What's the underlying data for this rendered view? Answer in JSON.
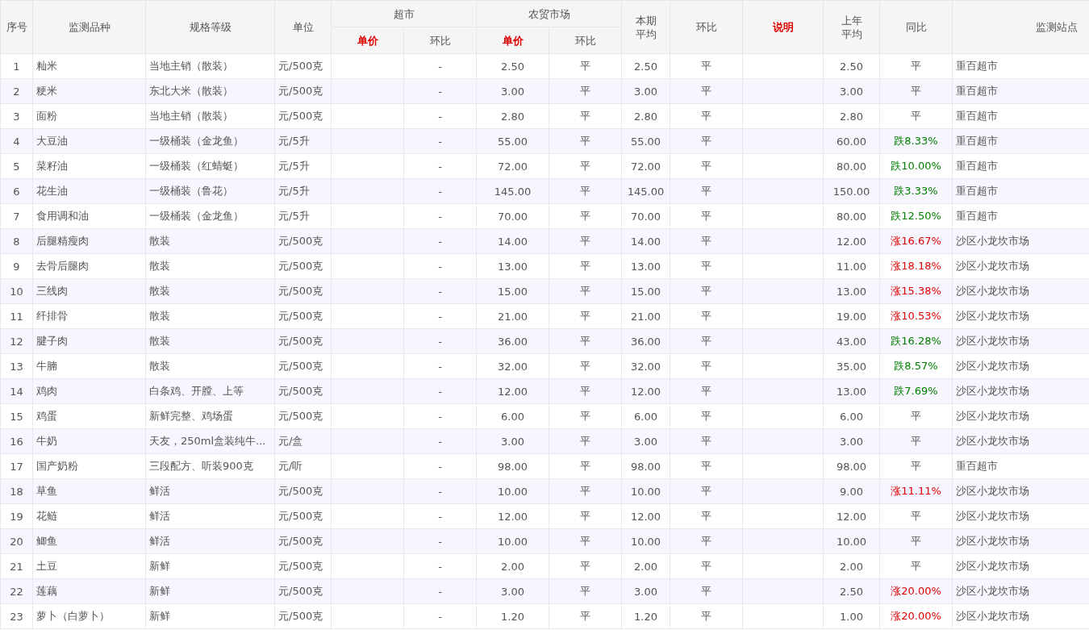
{
  "header": {
    "columns": [
      {
        "label": "序号",
        "highlight": false
      },
      {
        "label": "监测品种",
        "highlight": false
      },
      {
        "label": "规格等级",
        "highlight": false
      },
      {
        "label": "单位",
        "highlight": false
      },
      {
        "label": "超市",
        "highlight": false,
        "children": [
          {
            "label": "单价",
            "highlight": true
          },
          {
            "label": "环比",
            "highlight": false
          }
        ]
      },
      {
        "label": "农贸市场",
        "highlight": false,
        "children": [
          {
            "label": "单价",
            "highlight": true
          },
          {
            "label": "环比",
            "highlight": false
          }
        ]
      },
      {
        "label": "本期平均",
        "highlight": false,
        "wrapped": true
      },
      {
        "label": "环比",
        "highlight": false
      },
      {
        "label": "说明",
        "highlight": true
      },
      {
        "label": "上年平均",
        "highlight": false,
        "wrapped": true
      },
      {
        "label": "同比",
        "highlight": false
      },
      {
        "label": "监测站点",
        "highlight": false
      }
    ]
  },
  "rows": [
    {
      "no": "1",
      "item": "籼米",
      "spec": "当地主销（散装）",
      "unit": "元/500克",
      "super_change": "-",
      "market_price": "2.50",
      "market_change": "平",
      "avg": "2.50",
      "change": "平",
      "last_year": "2.50",
      "yoy": {
        "text": "平"
      },
      "station": "重百超市"
    },
    {
      "no": "2",
      "item": "粳米",
      "spec": "东北大米（散装）",
      "unit": "元/500克",
      "super_change": "-",
      "market_price": "3.00",
      "market_change": "平",
      "avg": "3.00",
      "change": "平",
      "last_year": "3.00",
      "yoy": {
        "text": "平"
      },
      "station": "重百超市"
    },
    {
      "no": "3",
      "item": "面粉",
      "spec": "当地主销（散装）",
      "unit": "元/500克",
      "super_change": "-",
      "market_price": "2.80",
      "market_change": "平",
      "avg": "2.80",
      "change": "平",
      "last_year": "2.80",
      "yoy": {
        "text": "平"
      },
      "station": "重百超市"
    },
    {
      "no": "4",
      "item": "大豆油",
      "spec": "一级桶装（金龙鱼）",
      "unit": "元/5升",
      "super_change": "-",
      "market_price": "55.00",
      "market_change": "平",
      "avg": "55.00",
      "change": "平",
      "last_year": "60.00",
      "yoy": {
        "text": "跌8.33%",
        "color": "#008000"
      },
      "station": "重百超市"
    },
    {
      "no": "5",
      "item": "菜籽油",
      "spec": "一级桶装（红蜻蜓）",
      "unit": "元/5升",
      "super_change": "-",
      "market_price": "72.00",
      "market_change": "平",
      "avg": "72.00",
      "change": "平",
      "last_year": "80.00",
      "yoy": {
        "text": "跌10.00%",
        "color": "#008000"
      },
      "station": "重百超市"
    },
    {
      "no": "6",
      "item": "花生油",
      "spec": "一级桶装（鲁花）",
      "unit": "元/5升",
      "super_change": "-",
      "market_price": "145.00",
      "market_change": "平",
      "avg": "145.00",
      "change": "平",
      "last_year": "150.00",
      "yoy": {
        "text": "跌3.33%",
        "color": "#008000"
      },
      "station": "重百超市"
    },
    {
      "no": "7",
      "item": "食用调和油",
      "spec": "一级桶装（金龙鱼）",
      "unit": "元/5升",
      "super_change": "-",
      "market_price": "70.00",
      "market_change": "平",
      "avg": "70.00",
      "change": "平",
      "last_year": "80.00",
      "yoy": {
        "text": "跌12.50%",
        "color": "#008000"
      },
      "station": "重百超市"
    },
    {
      "no": "8",
      "item": "后腿精瘦肉",
      "spec": "散装",
      "unit": "元/500克",
      "super_change": "-",
      "market_price": "14.00",
      "market_change": "平",
      "avg": "14.00",
      "change": "平",
      "last_year": "12.00",
      "yoy": {
        "text": "涨16.67%",
        "color": "#e00000"
      },
      "station": "沙区小龙坎市场"
    },
    {
      "no": "9",
      "item": "去骨后腿肉",
      "spec": "散装",
      "unit": "元/500克",
      "super_change": "-",
      "market_price": "13.00",
      "market_change": "平",
      "avg": "13.00",
      "change": "平",
      "last_year": "11.00",
      "yoy": {
        "text": "涨18.18%",
        "color": "#e00000"
      },
      "station": "沙区小龙坎市场"
    },
    {
      "no": "10",
      "item": "三线肉",
      "spec": "散装",
      "unit": "元/500克",
      "super_change": "-",
      "market_price": "15.00",
      "market_change": "平",
      "avg": "15.00",
      "change": "平",
      "last_year": "13.00",
      "yoy": {
        "text": "涨15.38%",
        "color": "#e00000"
      },
      "station": "沙区小龙坎市场"
    },
    {
      "no": "11",
      "item": "纤排骨",
      "spec": "散装",
      "unit": "元/500克",
      "super_change": "-",
      "market_price": "21.00",
      "market_change": "平",
      "avg": "21.00",
      "change": "平",
      "last_year": "19.00",
      "yoy": {
        "text": "涨10.53%",
        "color": "#e00000"
      },
      "station": "沙区小龙坎市场"
    },
    {
      "no": "12",
      "item": "腱子肉",
      "spec": "散装",
      "unit": "元/500克",
      "super_change": "-",
      "market_price": "36.00",
      "market_change": "平",
      "avg": "36.00",
      "change": "平",
      "last_year": "43.00",
      "yoy": {
        "text": "跌16.28%",
        "color": "#008000"
      },
      "station": "沙区小龙坎市场"
    },
    {
      "no": "13",
      "item": "牛腩",
      "spec": "散装",
      "unit": "元/500克",
      "super_change": "-",
      "market_price": "32.00",
      "market_change": "平",
      "avg": "32.00",
      "change": "平",
      "last_year": "35.00",
      "yoy": {
        "text": "跌8.57%",
        "color": "#008000"
      },
      "station": "沙区小龙坎市场"
    },
    {
      "no": "14",
      "item": "鸡肉",
      "spec": "白条鸡、开膛、上等",
      "unit": "元/500克",
      "super_change": "-",
      "market_price": "12.00",
      "market_change": "平",
      "avg": "12.00",
      "change": "平",
      "last_year": "13.00",
      "yoy": {
        "text": "跌7.69%",
        "color": "#008000"
      },
      "station": "沙区小龙坎市场"
    },
    {
      "no": "15",
      "item": "鸡蛋",
      "spec": "新鲜完整、鸡场蛋",
      "unit": "元/500克",
      "super_change": "-",
      "market_price": "6.00",
      "market_change": "平",
      "avg": "6.00",
      "change": "平",
      "last_year": "6.00",
      "yoy": {
        "text": "平"
      },
      "station": "沙区小龙坎市场"
    },
    {
      "no": "16",
      "item": "牛奶",
      "spec": "天友，250ml盒装纯牛...",
      "unit": "元/盒",
      "super_change": "-",
      "market_price": "3.00",
      "market_change": "平",
      "avg": "3.00",
      "change": "平",
      "last_year": "3.00",
      "yoy": {
        "text": "平"
      },
      "station": "沙区小龙坎市场"
    },
    {
      "no": "17",
      "item": "国产奶粉",
      "spec": "三段配方、听装900克",
      "unit": "元/听",
      "super_change": "-",
      "market_price": "98.00",
      "market_change": "平",
      "avg": "98.00",
      "change": "平",
      "last_year": "98.00",
      "yoy": {
        "text": "平"
      },
      "station": "重百超市"
    },
    {
      "no": "18",
      "item": "草鱼",
      "spec": "鲜活",
      "unit": "元/500克",
      "super_change": "-",
      "market_price": "10.00",
      "market_change": "平",
      "avg": "10.00",
      "change": "平",
      "last_year": "9.00",
      "yoy": {
        "text": "涨11.11%",
        "color": "#e00000"
      },
      "station": "沙区小龙坎市场"
    },
    {
      "no": "19",
      "item": "花鲢",
      "spec": "鲜活",
      "unit": "元/500克",
      "super_change": "-",
      "market_price": "12.00",
      "market_change": "平",
      "avg": "12.00",
      "change": "平",
      "last_year": "12.00",
      "yoy": {
        "text": "平"
      },
      "station": "沙区小龙坎市场"
    },
    {
      "no": "20",
      "item": "鲫鱼",
      "spec": "鲜活",
      "unit": "元/500克",
      "super_change": "-",
      "market_price": "10.00",
      "market_change": "平",
      "avg": "10.00",
      "change": "平",
      "last_year": "10.00",
      "yoy": {
        "text": "平"
      },
      "station": "沙区小龙坎市场"
    },
    {
      "no": "21",
      "item": "土豆",
      "spec": "新鲜",
      "unit": "元/500克",
      "super_change": "-",
      "market_price": "2.00",
      "market_change": "平",
      "avg": "2.00",
      "change": "平",
      "last_year": "2.00",
      "yoy": {
        "text": "平"
      },
      "station": "沙区小龙坎市场"
    },
    {
      "no": "22",
      "item": "莲藕",
      "spec": "新鲜",
      "unit": "元/500克",
      "super_change": "-",
      "market_price": "3.00",
      "market_change": "平",
      "avg": "3.00",
      "change": "平",
      "last_year": "2.50",
      "yoy": {
        "text": "涨20.00%",
        "color": "#e00000"
      },
      "station": "沙区小龙坎市场"
    },
    {
      "no": "23",
      "item": "萝卜（白萝卜）",
      "spec": "新鲜",
      "unit": "元/500克",
      "super_change": "-",
      "market_price": "1.20",
      "market_change": "平",
      "avg": "1.20",
      "change": "平",
      "last_year": "1.00",
      "yoy": {
        "text": "涨20.00%",
        "color": "#e00000"
      },
      "station": "沙区小龙坎市场"
    }
  ]
}
